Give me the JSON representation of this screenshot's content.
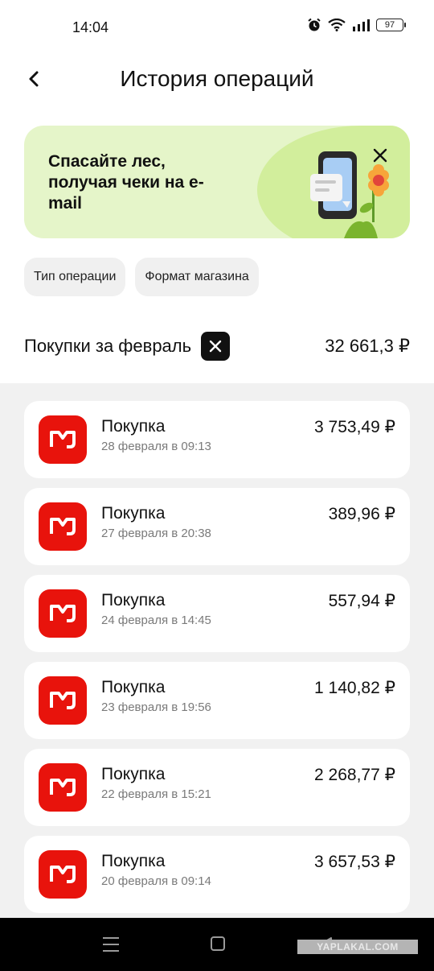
{
  "status_bar": {
    "time": "14:04",
    "battery": "97",
    "icons": [
      "alarm-icon",
      "wifi-icon",
      "signal-icon",
      "battery-icon"
    ]
  },
  "header": {
    "title": "История операций",
    "back_icon": "chevron-left-icon"
  },
  "banner": {
    "text": "Спасайте лес, получая чеки на e-mail",
    "close_icon": "close-icon",
    "colors": {
      "background": "#e5f5c9",
      "blob": "#d2ee9c"
    }
  },
  "filters": [
    {
      "label": "Тип операции"
    },
    {
      "label": "Формат магазина"
    }
  ],
  "summary": {
    "title": "Покупки за февраль",
    "total": "32 661,3 ₽"
  },
  "operations": [
    {
      "title": "Покупка",
      "date": "28 февраля в 09:13",
      "amount": "3 753,49 ₽"
    },
    {
      "title": "Покупка",
      "date": "27 февраля в 20:38",
      "amount": "389,96 ₽"
    },
    {
      "title": "Покупка",
      "date": "24 февраля в 14:45",
      "amount": "557,94 ₽"
    },
    {
      "title": "Покупка",
      "date": "23 февраля в 19:56",
      "amount": "1 140,82 ₽"
    },
    {
      "title": "Покупка",
      "date": "22 февраля в 15:21",
      "amount": "2 268,77 ₽"
    },
    {
      "title": "Покупка",
      "date": "20 февраля в 09:14",
      "amount": "3 657,53 ₽"
    }
  ],
  "brand_color": "#e8130c",
  "watermark": "YAPLAKAL.COM"
}
